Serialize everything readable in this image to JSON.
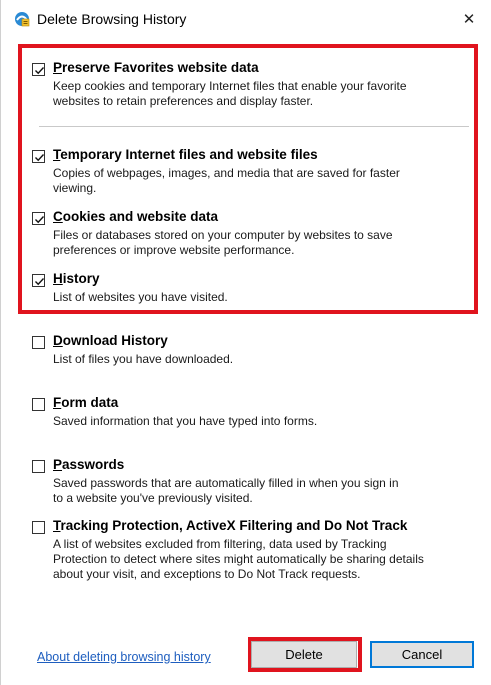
{
  "window": {
    "title": "Delete Browsing History",
    "close_glyph": "✕"
  },
  "options": [
    {
      "label": "Preserve Favorites website data",
      "description": "Keep cookies and temporary Internet files that enable your favorite\nwebsites to retain preferences and display faster.",
      "checked": true
    },
    {
      "label": "Temporary Internet files and website files",
      "description": "Copies of webpages, images, and media that are saved for faster\nviewing.",
      "checked": true
    },
    {
      "label": "Cookies and website data",
      "description": "Files or databases stored on your computer by websites to save\npreferences or improve website performance.",
      "checked": true
    },
    {
      "label": "History",
      "description": "List of websites you have visited.",
      "checked": true
    },
    {
      "label": "Download History",
      "description": "List of files you have downloaded.",
      "checked": false
    },
    {
      "label": "Form data",
      "description": "Saved information that you have typed into forms.",
      "checked": false
    },
    {
      "label": "Passwords",
      "description": "Saved passwords that are automatically filled in when you sign in\nto a website you've previously visited.",
      "checked": false
    },
    {
      "label": "Tracking Protection, ActiveX Filtering and Do Not Track",
      "description": "A list of websites excluded from filtering, data used by Tracking\nProtection to detect where sites might automatically be sharing details\nabout your visit, and exceptions to Do Not Track requests.",
      "checked": false
    }
  ],
  "footer": {
    "help_link": "About deleting browsing history",
    "delete_label": "Delete",
    "cancel_label": "Cancel"
  },
  "colors": {
    "highlight": "#e0141e",
    "link": "#1e5ebf",
    "focus": "#0078d7"
  }
}
